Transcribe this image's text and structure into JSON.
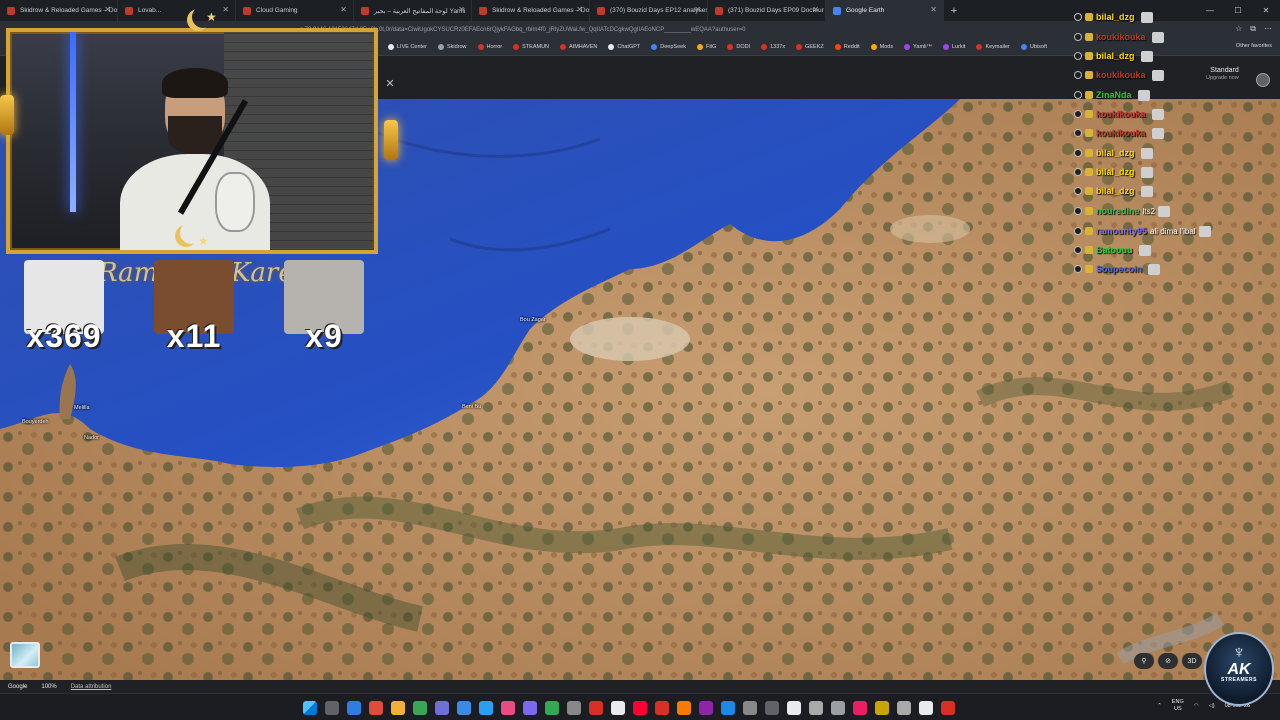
{
  "browser": {
    "tabs": [
      {
        "label": "Skidrow & Reloaded Games – Do",
        "active": false
      },
      {
        "label": "Lovab...",
        "active": false
      },
      {
        "label": "Cloud Gaming",
        "active": false
      },
      {
        "label": "لوحة المفاتيح العربية – بحبر Yamli",
        "active": false
      },
      {
        "label": "Skidrow & Reloaded Games – Do",
        "active": false
      },
      {
        "label": "(370) Bouzid Days EP12 analyses",
        "active": false
      },
      {
        "label": "(371) Bouzid Days EP09 Docteur p",
        "active": false
      },
      {
        "label": "Google Earth",
        "active": true
      }
    ],
    "new_tab": "+",
    "url": "s,79.9146.18153647d,35y,0h,0t,0r/data=CiwiUgokCYSUCRz0EFAEcn6rQjykFAGbq_rblm4f0_jRlyZUWaLfw_QqIIATcDCgkwQgIIAEoNCP________wEQAA?authuser=0",
    "bookmarks": [
      {
        "label": "LIVE Center",
        "color": "#e8eaed"
      },
      {
        "label": "Skidrow",
        "color": "#9aa0a6"
      },
      {
        "label": "Horror",
        "color": "#d93025"
      },
      {
        "label": "STEAMUN",
        "color": "#d93025"
      },
      {
        "label": "AIMHAVEN",
        "color": "#d93025"
      },
      {
        "label": "ChatGPT",
        "color": "#e8eaed"
      },
      {
        "label": "DeepSeek",
        "color": "#4285f4"
      },
      {
        "label": "FitG",
        "color": "#f9ab00"
      },
      {
        "label": "DODI",
        "color": "#d93025"
      },
      {
        "label": "1337x",
        "color": "#d93025"
      },
      {
        "label": "GEEKZ",
        "color": "#d93025"
      },
      {
        "label": "Reddit",
        "color": "#ff4500"
      },
      {
        "label": "Mods",
        "color": "#f9ab00"
      },
      {
        "label": "Yamli™",
        "color": "#a142f4"
      },
      {
        "label": "Lurkit",
        "color": "#a142f4"
      },
      {
        "label": "Keymailer",
        "color": "#d93025"
      },
      {
        "label": "Ubisoft",
        "color": "#4285f4"
      }
    ],
    "other_favorites": "Other favorites"
  },
  "earth": {
    "plan_title": "Standard",
    "plan_sub": "Upgrade now",
    "footer": {
      "brand": "Google",
      "zoom": "100%",
      "attribution": "Data attribution"
    },
    "places": [
      {
        "name": "Bou Zagar"
      },
      {
        "name": "Beni Bu"
      },
      {
        "name": "Melilla"
      },
      {
        "name": "Nador"
      },
      {
        "name": "Bouyerdeh"
      }
    ],
    "controls": {
      "view3d": "3D"
    }
  },
  "overlay": {
    "banner": "Ramadan Kareem",
    "emotes": [
      {
        "count": "x369",
        "color": "#e6e6e6"
      },
      {
        "count": "x11",
        "color": "#7a4d2e"
      },
      {
        "count": "x9",
        "color": "#b6b2ad"
      }
    ],
    "chat": [
      {
        "user": "bilal_dzg",
        "color": "#ffd700",
        "text": ""
      },
      {
        "user": "koukikouka",
        "color": "#c0392b",
        "text": ""
      },
      {
        "user": "bilal_dzg",
        "color": "#ffd700",
        "text": ""
      },
      {
        "user": "koukikouka",
        "color": "#c0392b",
        "text": ""
      },
      {
        "user": "ZinaNda",
        "color": "#2ecc40",
        "text": ""
      },
      {
        "user": "koukikouka",
        "color": "#c0392b",
        "text": ""
      },
      {
        "user": "koukikouka",
        "color": "#c0392b",
        "text": ""
      },
      {
        "user": "bilal_dzg",
        "color": "#ffd700",
        "text": ""
      },
      {
        "user": "bilal_dzg",
        "color": "#ffd700",
        "text": ""
      },
      {
        "user": "bilal_dzg",
        "color": "#ffd700",
        "text": ""
      },
      {
        "user": "nouredine",
        "color": "#2ecc40",
        "text": "lts2"
      },
      {
        "user": "ramounty95",
        "color": "#7b68ee",
        "text": "ali dima l'ibal"
      },
      {
        "user": "Batoouu",
        "color": "#2ecc40",
        "text": ""
      },
      {
        "user": "Soupecoin",
        "color": "#4169e1",
        "text": ""
      }
    ],
    "watermark": {
      "big": "AK",
      "small": "STREAMERS"
    }
  },
  "taskbar": {
    "lang": "ENG",
    "region": "US",
    "date": "08-Mar-26"
  }
}
